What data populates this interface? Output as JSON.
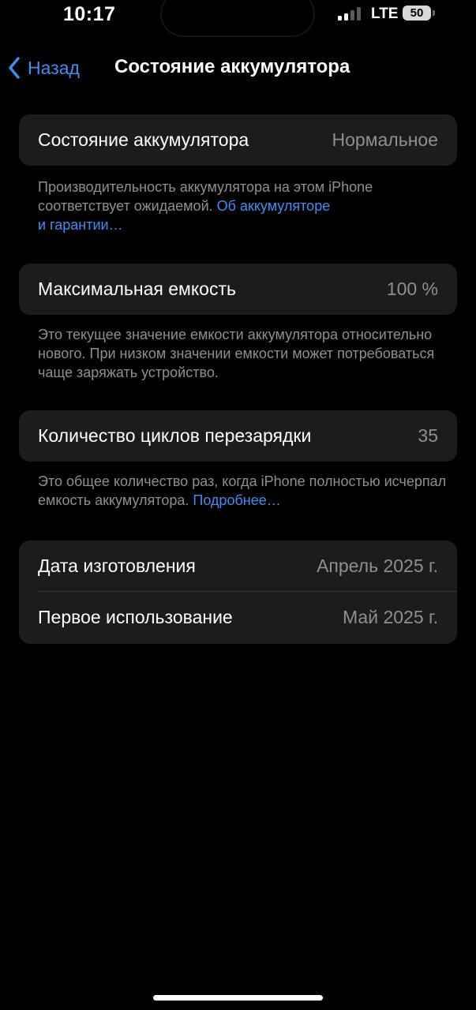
{
  "status_bar": {
    "time": "10:17",
    "network": "LTE",
    "battery_level": "50",
    "signal_bars_active": 2,
    "signal_bars_total": 4
  },
  "nav": {
    "back_label": "Назад",
    "title": "Состояние аккумулятора"
  },
  "battery_health": {
    "label": "Состояние аккумулятора",
    "value": "Нормальное",
    "footnote": "Производительность аккумулятора на этом iPhone соответствует ожидаемой. ",
    "footnote_link_line1": "Об аккумуляторе",
    "footnote_link_line2": "и гарантии…"
  },
  "max_capacity": {
    "label": "Максимальная емкость",
    "value": "100 %",
    "footnote": "Это текущее значение емкости аккумулятора относительно нового. При низком значении емкости может потребоваться чаще заряжать устройство."
  },
  "cycle_count": {
    "label": "Количество циклов перезарядки",
    "value": "35",
    "footnote": "Это общее количество раз, когда iPhone полностью исчерпал емкость аккумулятора. ",
    "footnote_link": "Подробнее…"
  },
  "dates": {
    "manufacture_label": "Дата изготовления",
    "manufacture_value": "Апрель 2025 г.",
    "first_use_label": "Первое использование",
    "first_use_value": "Май 2025 г."
  },
  "colors": {
    "accent": "#3b8ef5",
    "card": "#1c1c1e",
    "secondary_text": "#8e8e93"
  }
}
